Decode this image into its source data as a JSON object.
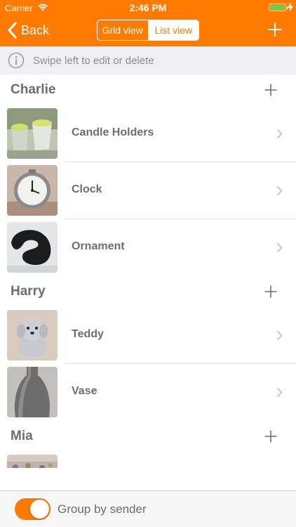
{
  "status": {
    "carrier": "Carrier",
    "time": "2:46 PM",
    "battery_color": "#4cd964"
  },
  "nav": {
    "back_label": "Back",
    "segments": [
      "Grid view",
      "List view"
    ],
    "selected_segment": "List view",
    "add_icon": "plus-icon",
    "accent": "#ff7a00"
  },
  "hint": {
    "text": "Swipe left to edit or delete",
    "icon": "info-icon"
  },
  "sections": [
    {
      "name": "Charlie",
      "items": [
        "Candle Holders",
        "Clock",
        "Ornament"
      ]
    },
    {
      "name": "Harry",
      "items": [
        "Teddy",
        "Vase"
      ]
    },
    {
      "name": "Mia",
      "items": []
    }
  ],
  "footer": {
    "toggle_label": "Group by sender",
    "toggle_on": true
  }
}
